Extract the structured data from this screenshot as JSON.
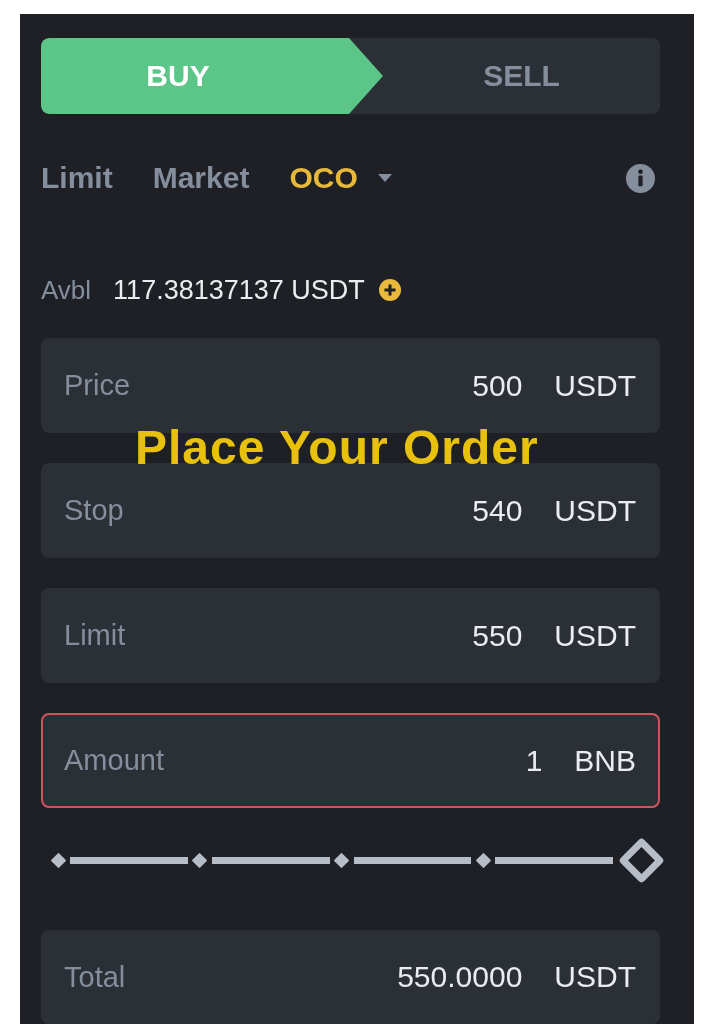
{
  "sides": [
    {
      "label": "BUY",
      "selected": true
    },
    {
      "label": "SELL",
      "selected": false
    }
  ],
  "order_types": [
    {
      "label": "Limit",
      "selected": false,
      "dropdown": false
    },
    {
      "label": "Market",
      "selected": false,
      "dropdown": false
    },
    {
      "label": "OCO",
      "selected": true,
      "dropdown": true
    }
  ],
  "balance": {
    "label": "Avbl",
    "value": "117.38137137 USDT"
  },
  "fields": [
    {
      "label": "Price",
      "value": "500",
      "unit": "USDT",
      "error": false
    },
    {
      "label": "Stop",
      "value": "540",
      "unit": "USDT",
      "error": false
    },
    {
      "label": "Limit",
      "value": "550",
      "unit": "USDT",
      "error": false
    },
    {
      "label": "Amount",
      "value": "1",
      "unit": "BNB",
      "error": true
    }
  ],
  "slider": {
    "level": 1
  },
  "total": {
    "label": "Total",
    "value": "550.0000",
    "unit": "USDT"
  },
  "caption": "Place Your Order"
}
